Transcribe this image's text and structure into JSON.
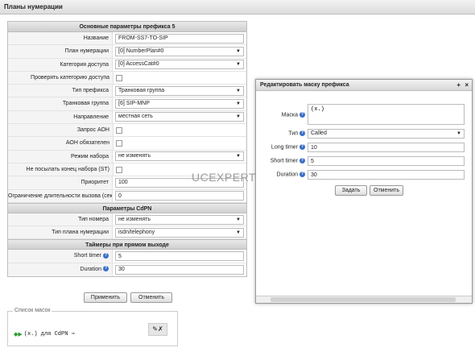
{
  "window": {
    "title": "Планы нумерации"
  },
  "form": {
    "header": "Основные параметры префикса 5",
    "fields": [
      {
        "label": "Название",
        "value": "FROM-SS7-TO-SIP"
      },
      {
        "label": "План нумерации",
        "value": "[0] NumberPlan#0"
      },
      {
        "label": "Категория доступа",
        "value": "[0] AccessCat#0"
      },
      {
        "label": "Проверять категорию доступа"
      },
      {
        "label": "Тип префикса",
        "value": "Транковая группа"
      },
      {
        "label": "Транковая группа",
        "value": "[6] SIP-MNP"
      },
      {
        "label": "Направление",
        "value": "местная сеть"
      },
      {
        "label": "Запрос АОН"
      },
      {
        "label": "АОН обязателен"
      },
      {
        "label": "Режим набора",
        "value": "не изменять"
      },
      {
        "label": "Не посылать конец набора (ST)"
      },
      {
        "label": "Приоритет",
        "value": "100"
      },
      {
        "label": "Ограничение длительности вызова (сек)",
        "value": "0"
      }
    ],
    "cdpn_header": "Параметры CdPN",
    "cdpn_fields": [
      {
        "label": "Тип номера",
        "value": "не изменять"
      },
      {
        "label": "Тип плана нумерации",
        "value": "isdn/telephony"
      }
    ],
    "timers_header": "Таймеры при прямом выходе",
    "timer_fields": [
      {
        "label": "Short timer",
        "value": "5"
      },
      {
        "label": "Duration",
        "value": "30"
      }
    ],
    "apply_label": "Применить",
    "cancel_label": "Отменить"
  },
  "mask_list": {
    "title": "Список масок",
    "item": "(x.) для CdPN ⇒"
  },
  "dialog": {
    "title": "Редактировать маску префикса",
    "mask_label": "Маска",
    "mask_value": "(x.)",
    "type_label": "Тип",
    "type_value": "Called",
    "long_timer_label": "Long timer",
    "long_timer_value": "10",
    "short_timer_label": "Short timer",
    "short_timer_value": "5",
    "duration_label": "Duration",
    "duration_value": "30",
    "set_label": "Задать",
    "cancel_label": "Отменить"
  },
  "watermark": "UCEXPERT.RU",
  "colors": {
    "help_icon": "#3a6fc9",
    "header_bg": "#dcdcdc"
  }
}
